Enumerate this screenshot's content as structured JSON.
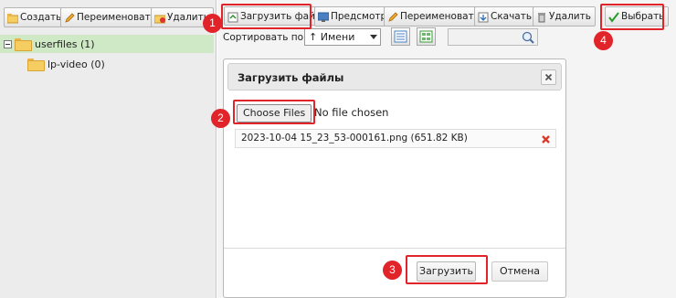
{
  "left_toolbar": {
    "create_label": "Создать",
    "rename_label": "Переименовать",
    "delete_label": "Удалить"
  },
  "tree": {
    "root_label": "userfiles (1)",
    "child_label": "lp-video (0)"
  },
  "right_toolbar": {
    "upload_label": "Загрузить файл",
    "preview_label": "Предсмотр",
    "rename_label": "Переименовать",
    "download_label": "Скачать",
    "delete_label": "Удалить",
    "select_label": "Выбрать"
  },
  "sort": {
    "label": "Сортировать по:",
    "selected": "↑ Имени"
  },
  "dialog": {
    "title": "Загрузить файлы",
    "choose_label": "Choose Files",
    "no_file_text": "No file chosen",
    "file_entry": "2023-10-04 15_23_53-000161.png (651.82 KB)",
    "upload_label": "Загрузить",
    "cancel_label": "Отмена"
  },
  "callouts": [
    "1",
    "2",
    "3",
    "4"
  ],
  "colors": {
    "accent_red": "#e0242a",
    "selection_green": "#cfe8c6"
  }
}
